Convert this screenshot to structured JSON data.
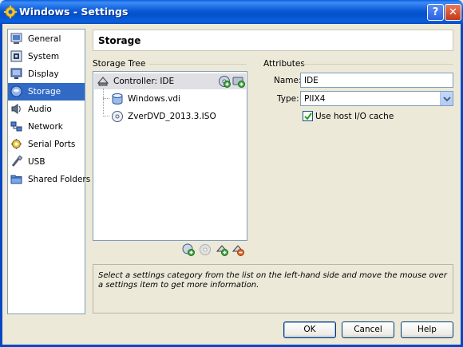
{
  "window": {
    "title": "Windows - Settings",
    "help_glyph": "?",
    "close_glyph": "✕"
  },
  "sidebar": {
    "items": [
      {
        "label": "General",
        "icon": "general-icon"
      },
      {
        "label": "System",
        "icon": "system-icon"
      },
      {
        "label": "Display",
        "icon": "display-icon"
      },
      {
        "label": "Storage",
        "icon": "storage-icon",
        "selected": true
      },
      {
        "label": "Audio",
        "icon": "audio-icon"
      },
      {
        "label": "Network",
        "icon": "network-icon"
      },
      {
        "label": "Serial Ports",
        "icon": "serial-ports-icon"
      },
      {
        "label": "USB",
        "icon": "usb-icon"
      },
      {
        "label": "Shared Folders",
        "icon": "shared-folders-icon"
      }
    ]
  },
  "page": {
    "title": "Storage"
  },
  "storage_tree": {
    "header": "Storage Tree",
    "controller": "Controller: IDE",
    "attachments": [
      {
        "label": "Windows.vdi",
        "icon": "hard-disk-icon"
      },
      {
        "label": "ZverDVD_2013.3.ISO",
        "icon": "optical-disc-icon"
      }
    ]
  },
  "attributes": {
    "header": "Attributes",
    "name_label": "Name:",
    "name_value": "IDE",
    "type_label": "Type:",
    "type_value": "PIIX4",
    "host_io_cache_label": "Use host I/O cache",
    "host_io_cache_checked": true
  },
  "info": {
    "text": "Select a settings category from the list on the left-hand side and move the mouse over a settings item to get more information."
  },
  "buttons": {
    "ok": "OK",
    "cancel": "Cancel",
    "help": "Help"
  }
}
